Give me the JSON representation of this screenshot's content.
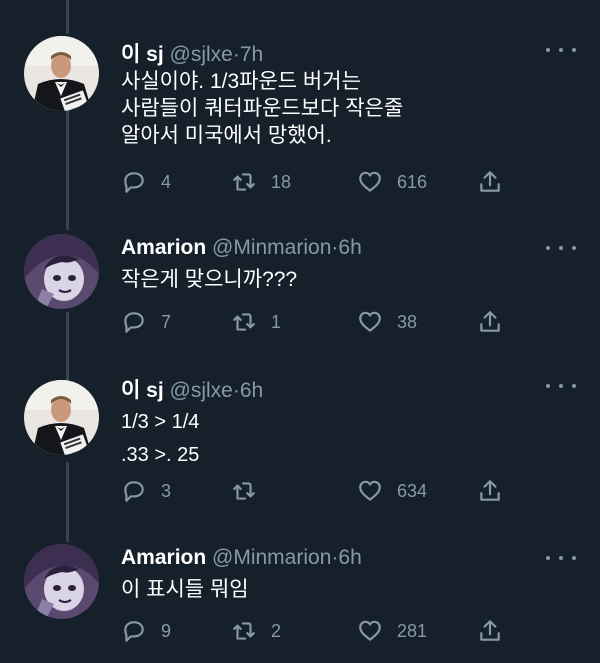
{
  "colors": {
    "background": "#15202b",
    "secondary_text": "#8899a6",
    "thread_line": "#38444d"
  },
  "tweets": [
    {
      "name": "이 sj",
      "handle": "@sjlxe",
      "dot": "·",
      "time": "7h",
      "text": "사실이야. 1/3파운드 버거는\n사람들이 쿼터파운드보다 작은줄\n알아서 미국에서 망했어.",
      "replies": "4",
      "retweets": "18",
      "likes": "616",
      "avatar": "man-in-tuxedo-avatar"
    },
    {
      "name": "Amarion",
      "handle": "@Minmarion",
      "dot": "·",
      "time": "6h",
      "text": "작은게 맞으니까???",
      "replies": "7",
      "retweets": "1",
      "likes": "38",
      "avatar": "anime-character-avatar"
    },
    {
      "name": "이 sj",
      "handle": "@sjlxe",
      "dot": "·",
      "time": "6h",
      "text": "1/3 > 1/4\n.33 >. 25",
      "replies": "3",
      "retweets": "",
      "likes": "634",
      "avatar": "man-in-tuxedo-avatar"
    },
    {
      "name": "Amarion",
      "handle": "@Minmarion",
      "dot": "·",
      "time": "6h",
      "text": "이 표시들 뭐임",
      "replies": "9",
      "retweets": "2",
      "likes": "281",
      "avatar": "anime-character-avatar"
    }
  ]
}
